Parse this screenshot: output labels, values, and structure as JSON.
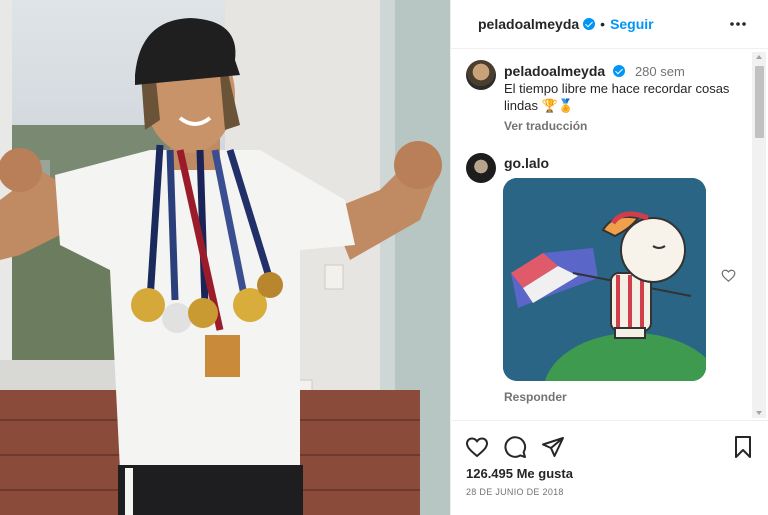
{
  "post": {
    "username": "peladoalmeyda",
    "separator": "•",
    "follow_label": "Seguir",
    "likes_text": "126.495 Me gusta",
    "date_text": "28 DE JUNIO DE 2018"
  },
  "caption": {
    "username": "peladoalmeyda",
    "time": "280 sem",
    "text": "El tiempo libre me hace recordar cosas lindas 🏆🏅",
    "see_translation": "Ver traducción"
  },
  "comment": {
    "username": "go.lalo",
    "reply_label": "Responder"
  },
  "icons": {
    "more": "more-horizontal-icon",
    "like": "heart-icon",
    "comment": "comment-icon",
    "share": "share-icon",
    "save": "bookmark-icon",
    "verified": "verified-badge-icon"
  },
  "colors": {
    "accent": "#0095f6",
    "text": "#262626",
    "muted": "#737373"
  }
}
